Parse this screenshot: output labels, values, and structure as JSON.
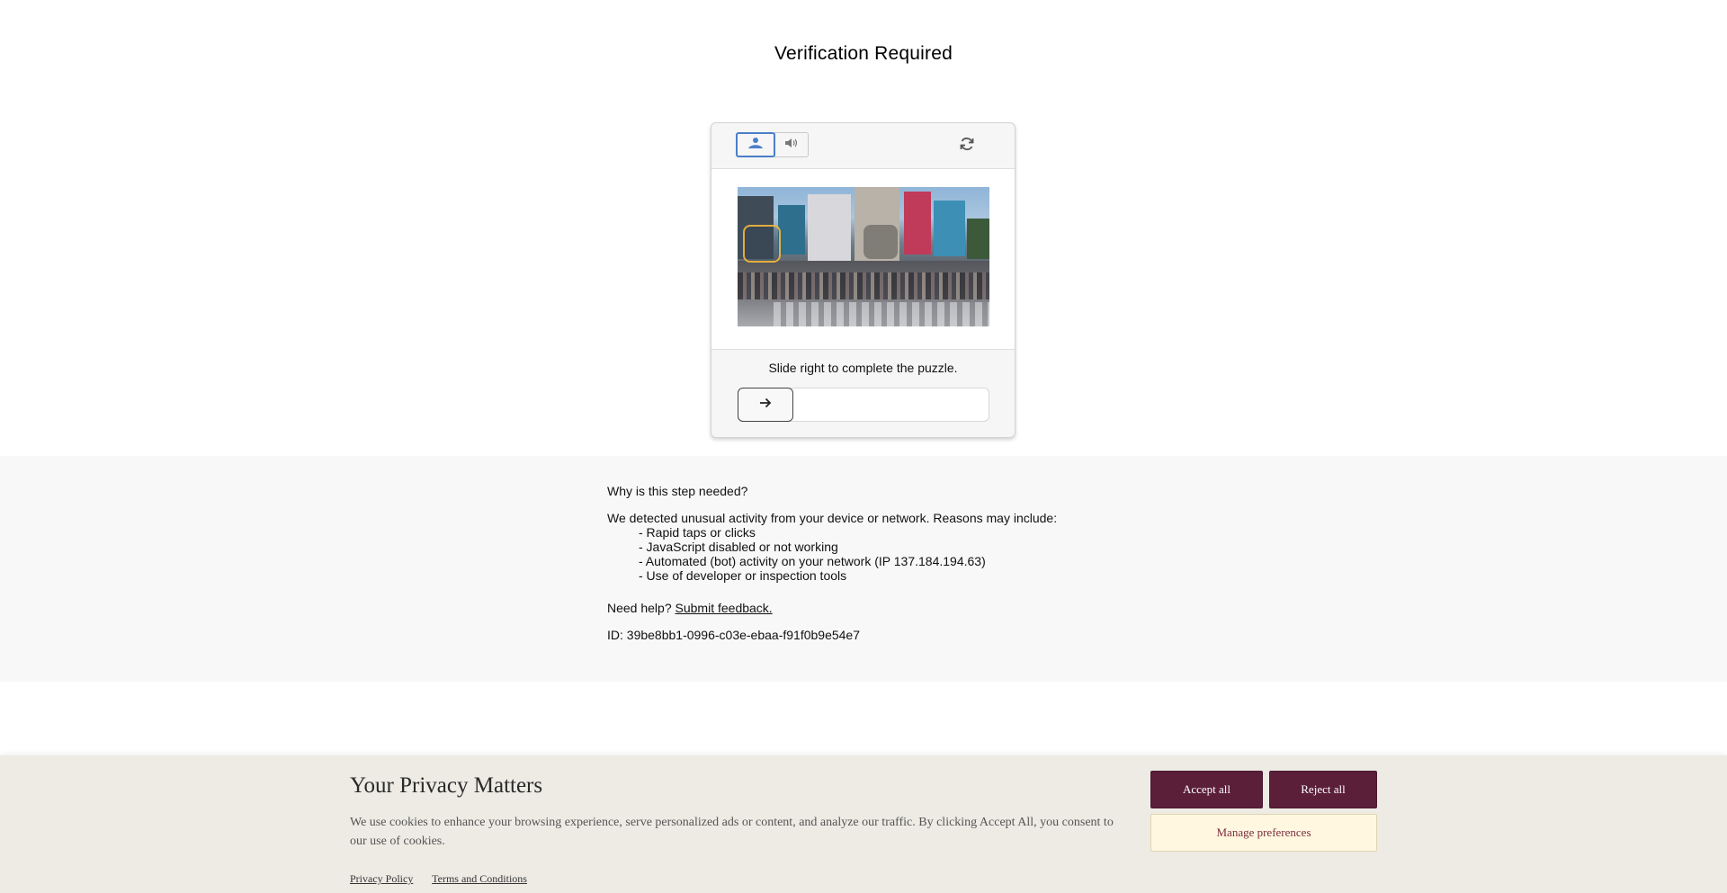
{
  "page": {
    "title": "Verification Required"
  },
  "captcha": {
    "mode_image_icon": "image-icon",
    "mode_audio_icon": "speaker-icon",
    "refresh_icon": "refresh-icon",
    "instruction": "Slide right to complete the puzzle.",
    "slider_icon": "arrow-right-icon",
    "slider_progress": 0,
    "accent": "#4a7fc9"
  },
  "info": {
    "question": "Why is this step needed?",
    "lead": "We detected unusual activity from your device or network. Reasons may include:",
    "reasons": [
      "- Rapid taps or clicks",
      "- JavaScript disabled or not working",
      "- Automated (bot) activity on your network (IP 137.184.194.63)",
      "- Use of developer or inspection tools"
    ],
    "help_prefix": "Need help?",
    "help_link": "Submit feedback.",
    "id_line": "ID: 39be8bb1-0996-c03e-ebaa-f91f0b9e54e7"
  },
  "cookie": {
    "title": "Your Privacy Matters",
    "description": "We use cookies to enhance your browsing experience, serve personalized ads or content, and analyze our traffic. By clicking Accept All, you consent to our use of cookies.",
    "privacy_link": "Privacy Policy",
    "terms_link": "Terms and Conditions",
    "accept_label": "Accept all",
    "reject_label": "Reject all",
    "manage_label": "Manage preferences",
    "brand_color": "#5b1f3a",
    "manage_bg": "#fff7df"
  }
}
